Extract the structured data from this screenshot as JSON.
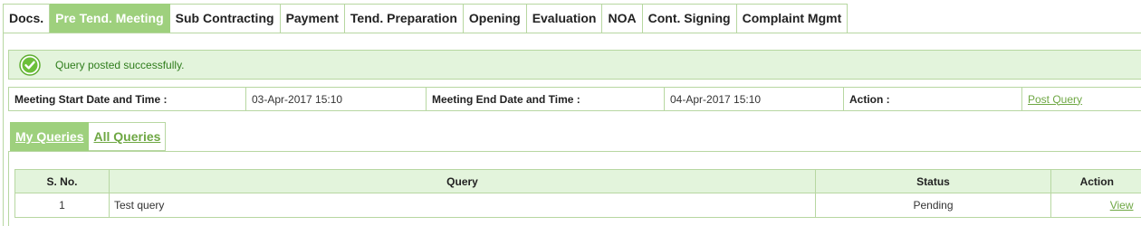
{
  "tabs": [
    {
      "label": "Docs.",
      "active": false
    },
    {
      "label": "Pre Tend. Meeting",
      "active": true
    },
    {
      "label": "Sub Contracting",
      "active": false
    },
    {
      "label": "Payment",
      "active": false
    },
    {
      "label": "Tend. Preparation",
      "active": false
    },
    {
      "label": "Opening",
      "active": false
    },
    {
      "label": "Evaluation",
      "active": false
    },
    {
      "label": "NOA",
      "active": false
    },
    {
      "label": "Cont. Signing",
      "active": false
    },
    {
      "label": "Complaint Mgmt",
      "active": false
    }
  ],
  "message": {
    "icon": "success-check-icon",
    "text": "Query posted successfully."
  },
  "meeting": {
    "start_label": "Meeting Start Date and Time :",
    "start_value": "03-Apr-2017 15:10",
    "end_label": "Meeting End Date and Time :",
    "end_value": "04-Apr-2017 15:10",
    "action_label": "Action :",
    "action_link": "Post Query"
  },
  "subtabs": [
    {
      "label": "My Queries",
      "active": true
    },
    {
      "label": "All Queries",
      "active": false
    }
  ],
  "queries": {
    "headers": {
      "sno": "S. No.",
      "query": "Query",
      "status": "Status",
      "action": "Action"
    },
    "rows": [
      {
        "sno": "1",
        "query": "Test query",
        "status": "Pending",
        "action": "View"
      }
    ]
  },
  "colors": {
    "accent": "#9ed07d",
    "border": "#b7d7a1",
    "light_bg": "#e3f4dc",
    "link": "#6ea743",
    "success_text": "#2f7d1c"
  }
}
